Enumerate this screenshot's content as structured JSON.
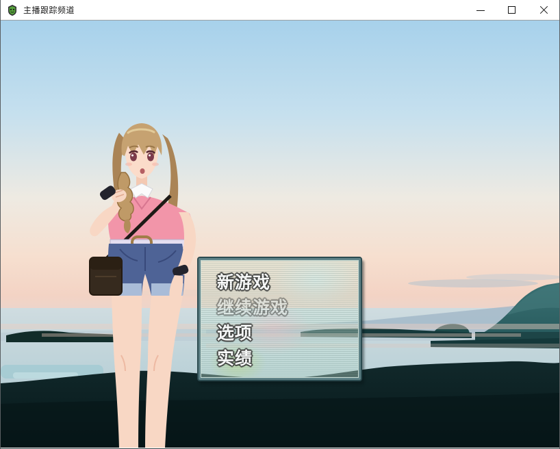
{
  "window": {
    "title": "主播跟踪频道",
    "icon": "game-sprite-icon",
    "controls": {
      "minimize_icon": "minimize-line",
      "maximize_icon": "maximize-square",
      "close_icon": "close-x"
    }
  },
  "menu": {
    "items": [
      {
        "label": "新游戏",
        "enabled": true
      },
      {
        "label": "继续游戏",
        "enabled": false
      },
      {
        "label": "选项",
        "enabled": true
      },
      {
        "label": "实绩",
        "enabled": true
      }
    ]
  },
  "scene": {
    "colors": {
      "sky_top": "#a7d1eb",
      "sky_horizon_pink": "#f5d8c8",
      "sea": "#b4cdd5",
      "mountain_teal": "#2e6164",
      "foreground_dark": "#0c2224",
      "menu_frame": "#5f8287",
      "character_hair": "#c6a271",
      "character_top_pink": "#f295a9",
      "character_shorts_blue": "#4e6396"
    }
  }
}
